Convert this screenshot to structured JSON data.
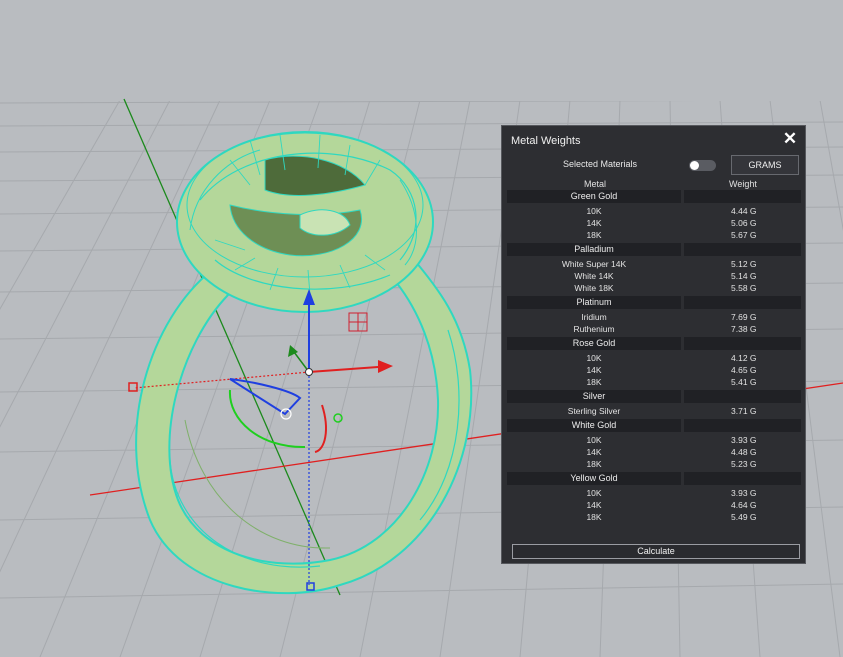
{
  "panel": {
    "title": "Metal Weights",
    "close_glyph": "✕",
    "selected_materials_label": "Selected Materials",
    "selected_materials_on": false,
    "units_label": "GRAMS",
    "col_metal": "Metal",
    "col_weight": "Weight",
    "calculate_label": "Calculate",
    "groups": [
      {
        "name": "Green Gold",
        "rows": [
          [
            "10K",
            "4.44 G"
          ],
          [
            "14K",
            "5.06 G"
          ],
          [
            "18K",
            "5.67 G"
          ]
        ]
      },
      {
        "name": "Palladium",
        "rows": [
          [
            "White Super 14K",
            "5.12 G"
          ],
          [
            "White 14K",
            "5.14 G"
          ],
          [
            "White 18K",
            "5.58 G"
          ]
        ]
      },
      {
        "name": "Platinum",
        "rows": [
          [
            "Iridium",
            "7.69 G"
          ],
          [
            "Ruthenium",
            "7.38 G"
          ]
        ]
      },
      {
        "name": "Rose Gold",
        "rows": [
          [
            "10K",
            "4.12 G"
          ],
          [
            "14K",
            "4.65 G"
          ],
          [
            "18K",
            "5.41 G"
          ]
        ]
      },
      {
        "name": "Silver",
        "rows": [
          [
            "Sterling Silver",
            "3.71 G"
          ]
        ]
      },
      {
        "name": "White Gold",
        "rows": [
          [
            "10K",
            "3.93 G"
          ],
          [
            "14K",
            "4.48 G"
          ],
          [
            "18K",
            "5.23 G"
          ]
        ]
      },
      {
        "name": "Yellow Gold",
        "rows": [
          [
            "10K",
            "3.93 G"
          ],
          [
            "14K",
            "4.64 G"
          ],
          [
            "18K",
            "5.49 G"
          ]
        ]
      }
    ]
  },
  "colors": {
    "viewport_bg": "#b9bcc0",
    "grid_line": "#a6a9ad",
    "ring_fill": "#b4d79a",
    "ring_wire": "#2fd8c0",
    "axis_x": "#e02020",
    "axis_y": "#1c8a1c",
    "gizmo_z": "#1f3fe0"
  },
  "viewport": {
    "icons": [
      "gumball-move-arrow-z-icon",
      "gumball-move-arrow-x-icon",
      "gumball-rotate-arc-icon",
      "gumball-scale-handle-icon",
      "gumball-plane-handle-icon"
    ]
  }
}
